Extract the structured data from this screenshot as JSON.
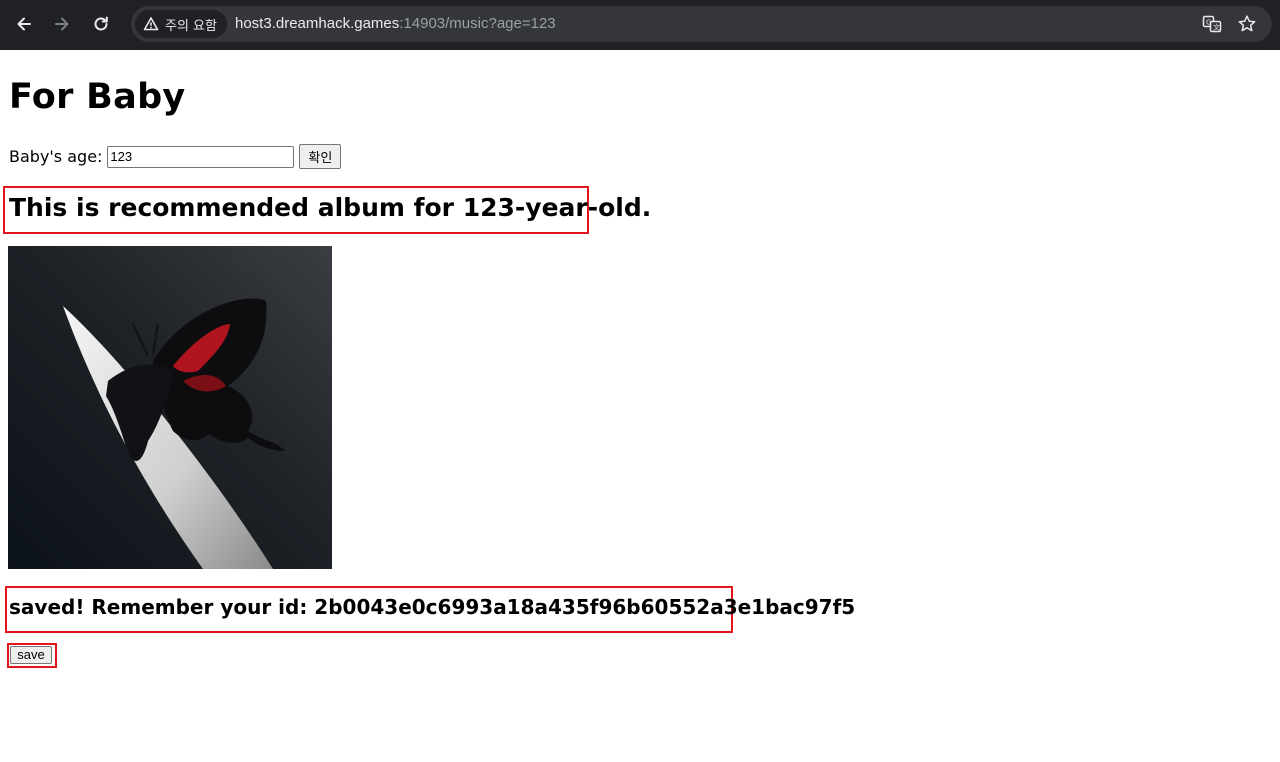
{
  "browser": {
    "security_label": "주의 요함",
    "url_host": "host3.dreamhack.games",
    "url_rest": ":14903/music?age=123"
  },
  "page": {
    "title": "For Baby",
    "age_label": "Baby's age:",
    "age_value": "123",
    "confirm_label": "확인",
    "recommendation": "This is recommended album for 123-year-old.",
    "saved_message": "saved! Remember your id: 2b0043e0c6993a18a435f96b60552a3e1bac97f5",
    "save_label": "save"
  },
  "colors": {
    "highlight": "#e3141e",
    "chrome_bg": "#202124",
    "omnibox_bg": "#35363a"
  },
  "icons": [
    "back-arrow-icon",
    "forward-arrow-icon",
    "reload-icon",
    "warning-icon",
    "translate-icon",
    "star-icon"
  ]
}
